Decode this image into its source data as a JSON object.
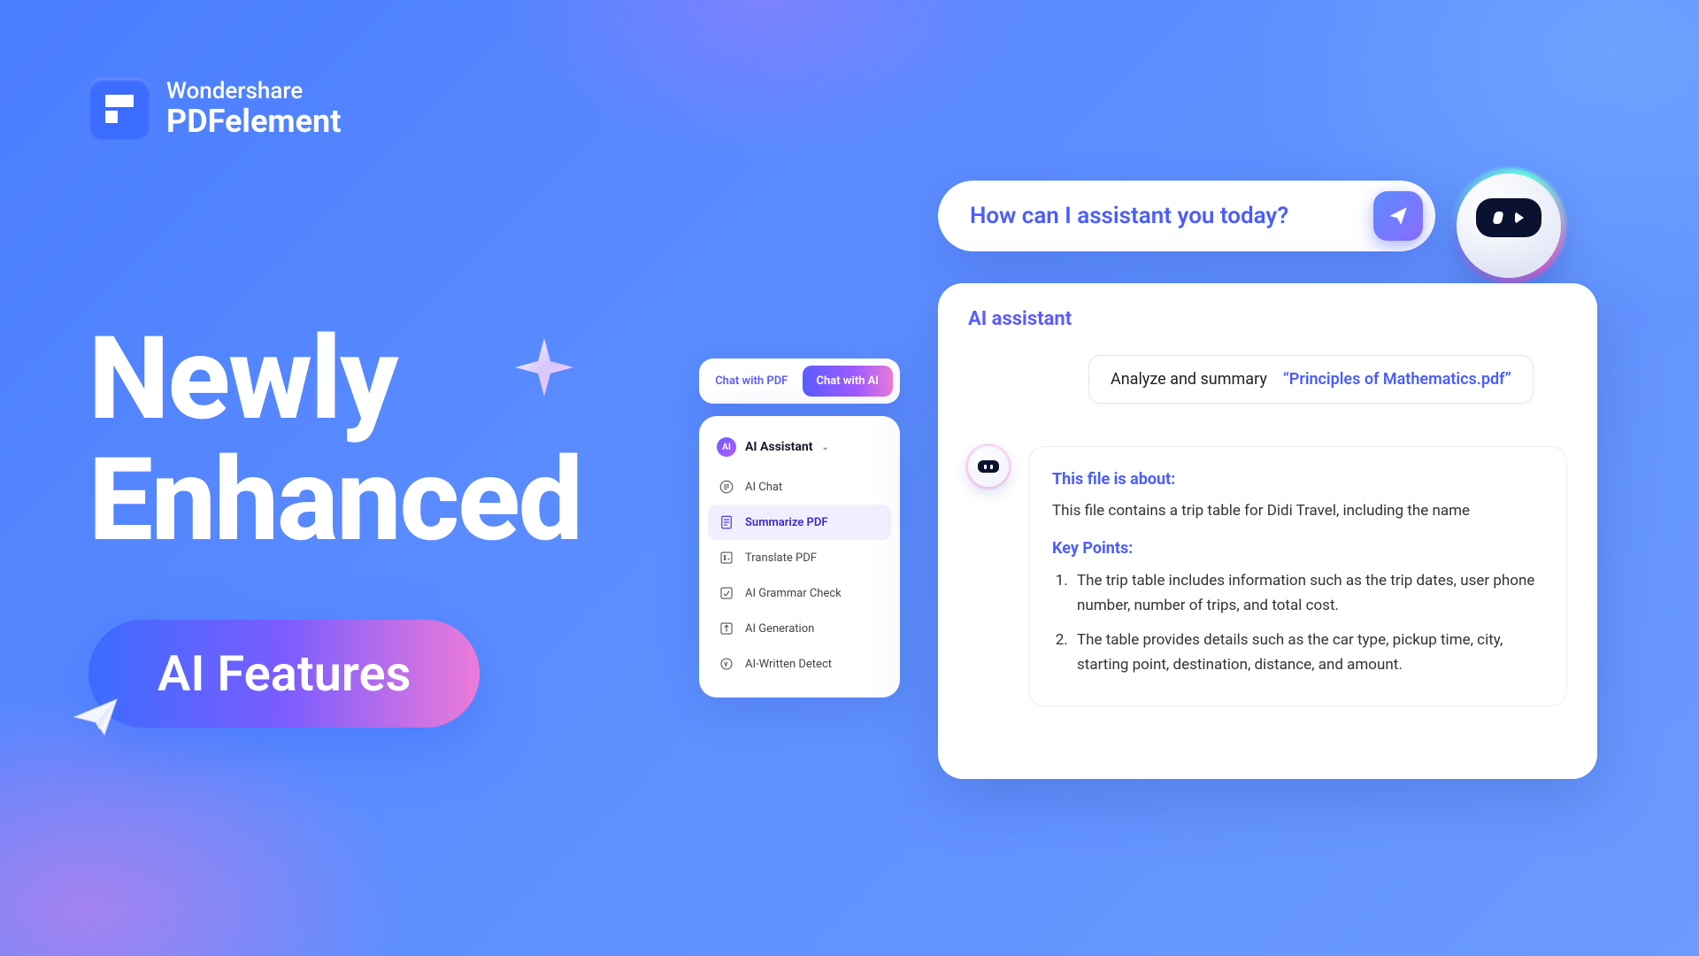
{
  "logo": {
    "brand": "Wondershare",
    "product": "PDFelement"
  },
  "headline": {
    "line1": "Newly",
    "line2": "Enhanced",
    "pill": "AI Features"
  },
  "tabs": {
    "inactive": "Chat with PDF",
    "active": "Chat with AI"
  },
  "menu": {
    "header": "AI Assistant",
    "badge": "AI",
    "items": [
      {
        "label": "AI Chat",
        "selected": false
      },
      {
        "label": "Summarize PDF",
        "selected": true
      },
      {
        "label": "Translate PDF",
        "selected": false
      },
      {
        "label": "AI Grammar Check",
        "selected": false
      },
      {
        "label": "AI Generation",
        "selected": false
      },
      {
        "label": "AI-Written Detect",
        "selected": false
      }
    ]
  },
  "prompt": {
    "text": "How can I assistant you today?"
  },
  "assistant": {
    "title": "AI assistant",
    "query_prefix": "Analyze and summary",
    "query_filename": "“Principles of Mathematics.pdf”",
    "about_heading": "This file is about:",
    "about_body": "This file contains a trip table for Didi Travel, including the name",
    "keypoints_heading": "Key Points:",
    "points": [
      "The trip table includes information such as the trip dates, user phone number, number of trips, and total cost.",
      "The table provides details such as the car type, pickup time, city, starting point, destination, distance, and amount."
    ]
  }
}
